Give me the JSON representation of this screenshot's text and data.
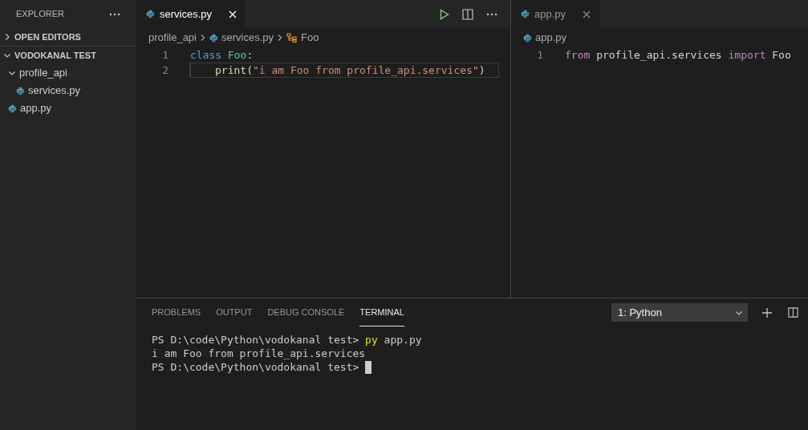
{
  "sidebar": {
    "title": "EXPLORER",
    "sections": [
      {
        "label": "OPEN EDITORS",
        "expanded": false
      },
      {
        "label": "VODOKANAL TEST",
        "expanded": true,
        "items": [
          {
            "kind": "folder",
            "label": "profile_api",
            "expanded": true,
            "children": [
              {
                "kind": "file",
                "label": "services.py"
              }
            ]
          },
          {
            "kind": "file",
            "label": "app.py"
          }
        ]
      }
    ]
  },
  "editor_groups": [
    {
      "focused": true,
      "tabs": [
        {
          "label": "services.py",
          "selected": true
        }
      ],
      "breadcrumbs": [
        {
          "kind": "folder",
          "label": "profile_api"
        },
        {
          "kind": "file",
          "label": "services.py"
        },
        {
          "kind": "class",
          "label": "Foo"
        }
      ],
      "lines": [
        {
          "number": "1",
          "current": false,
          "indent": false,
          "tokens": [
            {
              "kind": "keyword",
              "text": "class"
            },
            {
              "kind": "type",
              "text": " Foo"
            },
            {
              "kind": "plain",
              "text": ":"
            }
          ]
        },
        {
          "number": "2",
          "current": true,
          "indent": true,
          "tokens": [
            {
              "kind": "function",
              "text": "print"
            },
            {
              "kind": "plain",
              "text": "("
            },
            {
              "kind": "string",
              "text": "\"i am Foo from profile_api.services\""
            },
            {
              "kind": "plain",
              "text": ")"
            }
          ]
        }
      ]
    },
    {
      "focused": false,
      "tabs": [
        {
          "label": "app.py",
          "selected": true
        }
      ],
      "breadcrumbs": [
        {
          "kind": "file",
          "label": "app.py"
        }
      ],
      "lines": [
        {
          "number": "1",
          "current": false,
          "indent": false,
          "tokens": [
            {
              "kind": "control",
              "text": "from"
            },
            {
              "kind": "plain",
              "text": " profile_api.services "
            },
            {
              "kind": "control",
              "text": "import"
            },
            {
              "kind": "plain",
              "text": " Foo"
            }
          ]
        }
      ]
    }
  ],
  "panel": {
    "tabs": [
      {
        "label": "PROBLEMS",
        "selected": false
      },
      {
        "label": "OUTPUT",
        "selected": false
      },
      {
        "label": "DEBUG CONSOLE",
        "selected": false
      },
      {
        "label": "TERMINAL",
        "selected": true
      }
    ],
    "terminal_select": "1: Python",
    "terminal_lines": [
      {
        "cursor": false,
        "segments": [
          {
            "kind": "plain",
            "text": "PS D:\\code\\Python\\vodokanal test> "
          },
          {
            "kind": "command",
            "text": "py"
          },
          {
            "kind": "plain",
            "text": " app.py"
          }
        ]
      },
      {
        "cursor": false,
        "segments": [
          {
            "kind": "plain",
            "text": "i am Foo from profile_api.services"
          }
        ]
      },
      {
        "cursor": true,
        "segments": [
          {
            "kind": "plain",
            "text": "PS D:\\code\\Python\\vodokanal test> "
          }
        ]
      }
    ]
  }
}
